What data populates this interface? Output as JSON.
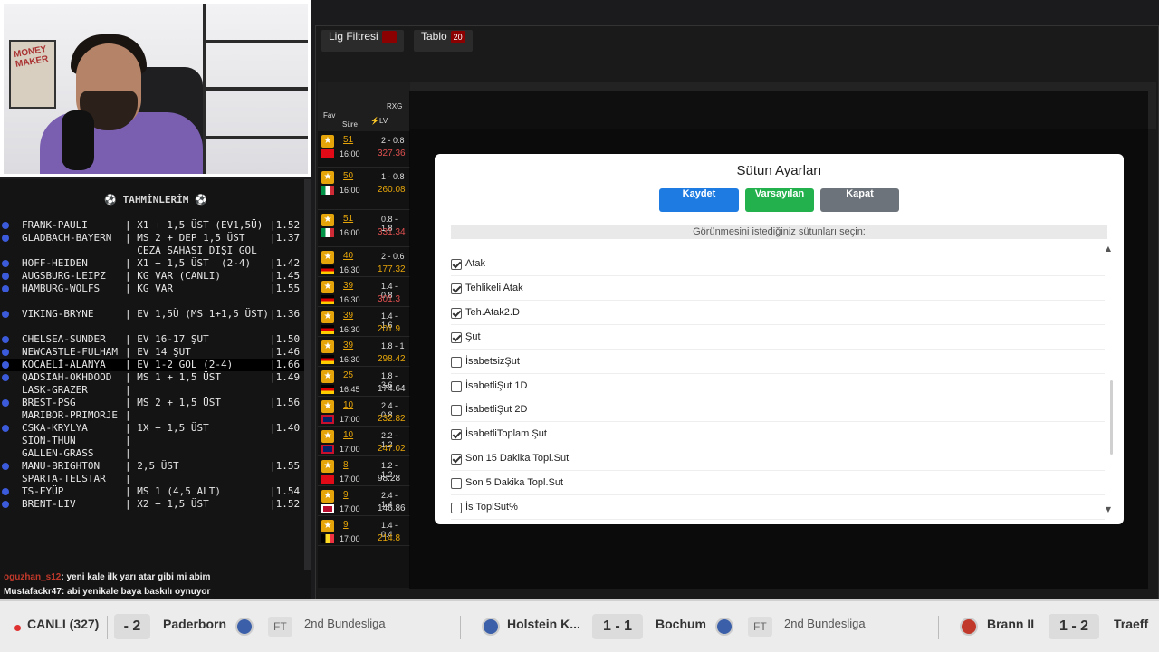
{
  "predictions": {
    "title": "⚽ TAHMİNLERİM ⚽",
    "rows": [
      {
        "match": "FRANK-PAULI",
        "pick": "| X1 + 1,5 ÜST (EV1,5Ü)",
        "odd": "|1.52",
        "dot": true
      },
      {
        "match": "GLADBACH-BAYERN",
        "pick": "| MS 2 + DEP 1,5 ÜST",
        "odd": "|1.37",
        "dot": true
      },
      {
        "match": "",
        "pick": "  CEZA SAHASI DIŞI GOL",
        "odd": "",
        "dot": false
      },
      {
        "match": "HOFF-HEIDEN",
        "pick": "| X1 + 1,5 ÜST  (2-4)",
        "odd": "|1.42",
        "dot": true
      },
      {
        "match": "AUGSBURG-LEIPZ",
        "pick": "| KG VAR (CANLI)",
        "odd": "|1.45",
        "dot": true
      },
      {
        "match": "HAMBURG-WOLFS",
        "pick": "| KG VAR",
        "odd": "|1.55",
        "dot": true
      },
      {
        "match": "",
        "pick": "",
        "odd": "",
        "dot": false
      },
      {
        "match": "VIKING-BRYNE",
        "pick": "| EV 1,5Ü (MS 1+1,5 ÜST)",
        "odd": "|1.36",
        "dot": true
      },
      {
        "match": "",
        "pick": "",
        "odd": "",
        "dot": false
      },
      {
        "match": "CHELSEA-SUNDER",
        "pick": "| EV 16-17 ŞUT",
        "odd": "|1.50",
        "dot": true
      },
      {
        "match": "NEWCASTLE-FULHAM",
        "pick": "| EV 14 ŞUT",
        "odd": "|1.46",
        "dot": true
      },
      {
        "match": "KOCAELİ-ALANYA",
        "pick": "| EV 1-2 GOL (2-4)",
        "odd": "|1.66",
        "dot": true,
        "hl": true
      },
      {
        "match": "QADSIAH-OKHDOOD",
        "pick": "| MS 1 + 1,5 ÜST",
        "odd": "|1.49",
        "dot": true
      },
      {
        "match": "LASK-GRAZER",
        "pick": "|",
        "odd": "",
        "dot": false
      },
      {
        "match": "BREST-PSG",
        "pick": "| MS 2 + 1,5 ÜST",
        "odd": "|1.56",
        "dot": true
      },
      {
        "match": "MARIBOR-PRIMORJE",
        "pick": "|",
        "odd": "",
        "dot": false
      },
      {
        "match": "CSKA-KRYLYA",
        "pick": "| 1X + 1,5 ÜST",
        "odd": "|1.40",
        "dot": true
      },
      {
        "match": "SION-THUN",
        "pick": "|",
        "odd": "",
        "dot": false
      },
      {
        "match": "GALLEN-GRASS",
        "pick": "|",
        "odd": "",
        "dot": false
      },
      {
        "match": "MANU-BRIGHTON",
        "pick": "| 2,5 ÜST",
        "odd": "|1.55",
        "dot": true
      },
      {
        "match": "SPARTA-TELSTAR",
        "pick": "|",
        "odd": "",
        "dot": false
      },
      {
        "match": "TS-EYÜP",
        "pick": "| MS 1 (4,5 ALT)",
        "odd": "|1.54",
        "dot": true
      },
      {
        "match": "BRENT-LIV",
        "pick": "| X2 + 1,5 ÜST",
        "odd": "|1.52",
        "dot": true
      }
    ]
  },
  "chat": [
    {
      "user": "oguzhan_s12",
      "text": ": yeni kale ilk yarı atar gibi mi abim"
    },
    {
      "user": "Mustafackr47",
      "text": ": abi yenikale baya baskılı oynuyor"
    }
  ],
  "tabs": {
    "league_filter": "Lig Filtresi",
    "table": "Tablo",
    "table_count": "20"
  },
  "grid_header": {
    "fav": "Fav",
    "sure": "Süre",
    "rxg": "RXG",
    "lv": "⚡LV"
  },
  "grid_rows": [
    {
      "min": "51",
      "time": "16:00",
      "score": "2 - 0.8",
      "rxg": "327.36",
      "rxg_color": "#e05050",
      "flag": "tr"
    },
    {
      "min": "50",
      "time": "16:00",
      "score": "1 - 0.8",
      "rxg": "260.08",
      "rxg_color": "#e5a50a",
      "flag": "it"
    },
    {
      "min": "51",
      "time": "16:00",
      "score": "0.8 - 1.8",
      "rxg": "331.34",
      "rxg_color": "#e05050",
      "flag": "it"
    },
    {
      "min": "40",
      "time": "16:30",
      "score": "2 - 0.6",
      "rxg": "177.32",
      "rxg_color": "#e5a50a",
      "flag": "de"
    },
    {
      "min": "39",
      "time": "16:30",
      "score": "1.4 - 0.8",
      "rxg": "301.3",
      "rxg_color": "#e05050",
      "flag": "de"
    },
    {
      "min": "39",
      "time": "16:30",
      "score": "1.4 - 1.6",
      "rxg": "201.9",
      "rxg_color": "#e5a50a",
      "flag": "de"
    },
    {
      "min": "39",
      "time": "16:30",
      "score": "1.8 - 1",
      "rxg": "298.42",
      "rxg_color": "#e5a50a",
      "flag": "de"
    },
    {
      "min": "25",
      "time": "16:45",
      "score": "1.8 - 3.6",
      "rxg": "174.64",
      "rxg_color": "#dddddd",
      "flag": "de"
    },
    {
      "min": "10",
      "time": "17:00",
      "score": "2.4 - 0.8",
      "rxg": "232.82",
      "rxg_color": "#e5a50a",
      "flag": "gb"
    },
    {
      "min": "10",
      "time": "17:00",
      "score": "2.2 - 1.2",
      "rxg": "247.02",
      "rxg_color": "#e5a50a",
      "flag": "gb"
    },
    {
      "min": "8",
      "time": "17:00",
      "score": "1.2 - 1.2",
      "rxg": "98.28",
      "rxg_color": "#dddddd",
      "flag": "tr"
    },
    {
      "min": "9",
      "time": "17:00",
      "score": "2.4 - 1.4",
      "rxg": "146.86",
      "rxg_color": "#dddddd",
      "flag": "no"
    },
    {
      "min": "9",
      "time": "17:00",
      "score": "1.4 - 0.4",
      "rxg": "214.8",
      "rxg_color": "#e5a50a",
      "flag": "be"
    }
  ],
  "modal": {
    "title": "Sütun Ayarları",
    "save": "Kaydet",
    "default": "Varsayılan",
    "close": "Kapat",
    "hint": "Görünmesini istediğiniz sütunları seçin:",
    "options": [
      {
        "label": "Atak",
        "checked": true
      },
      {
        "label": "Tehlikeli Atak",
        "checked": true
      },
      {
        "label": "Teh.Atak2.D",
        "checked": true
      },
      {
        "label": "Şut",
        "checked": true
      },
      {
        "label": "İsabetsizŞut",
        "checked": false
      },
      {
        "label": "İsabetliŞut 1D",
        "checked": false
      },
      {
        "label": "İsabetliŞut 2D",
        "checked": false
      },
      {
        "label": "İsabetliToplam Şut",
        "checked": true
      },
      {
        "label": "Son 15 Dakika Topl.Sut",
        "checked": true
      },
      {
        "label": "Son 5 Dakika Topl.Sut",
        "checked": false
      },
      {
        "label": "İs ToplSut%",
        "checked": false
      }
    ]
  },
  "ticker": {
    "live": "CANLI (327)",
    "m1": {
      "score": "- 2",
      "team": "Paderborn",
      "status": "FT",
      "league": "2nd Bundesliga"
    },
    "m2": {
      "home": "Holstein K...",
      "score": "1 - 1",
      "away": "Bochum",
      "status": "FT",
      "league": "2nd Bundesliga"
    },
    "m3": {
      "home": "Brann II",
      "score": "1 - 2",
      "away": "Traeff"
    }
  }
}
